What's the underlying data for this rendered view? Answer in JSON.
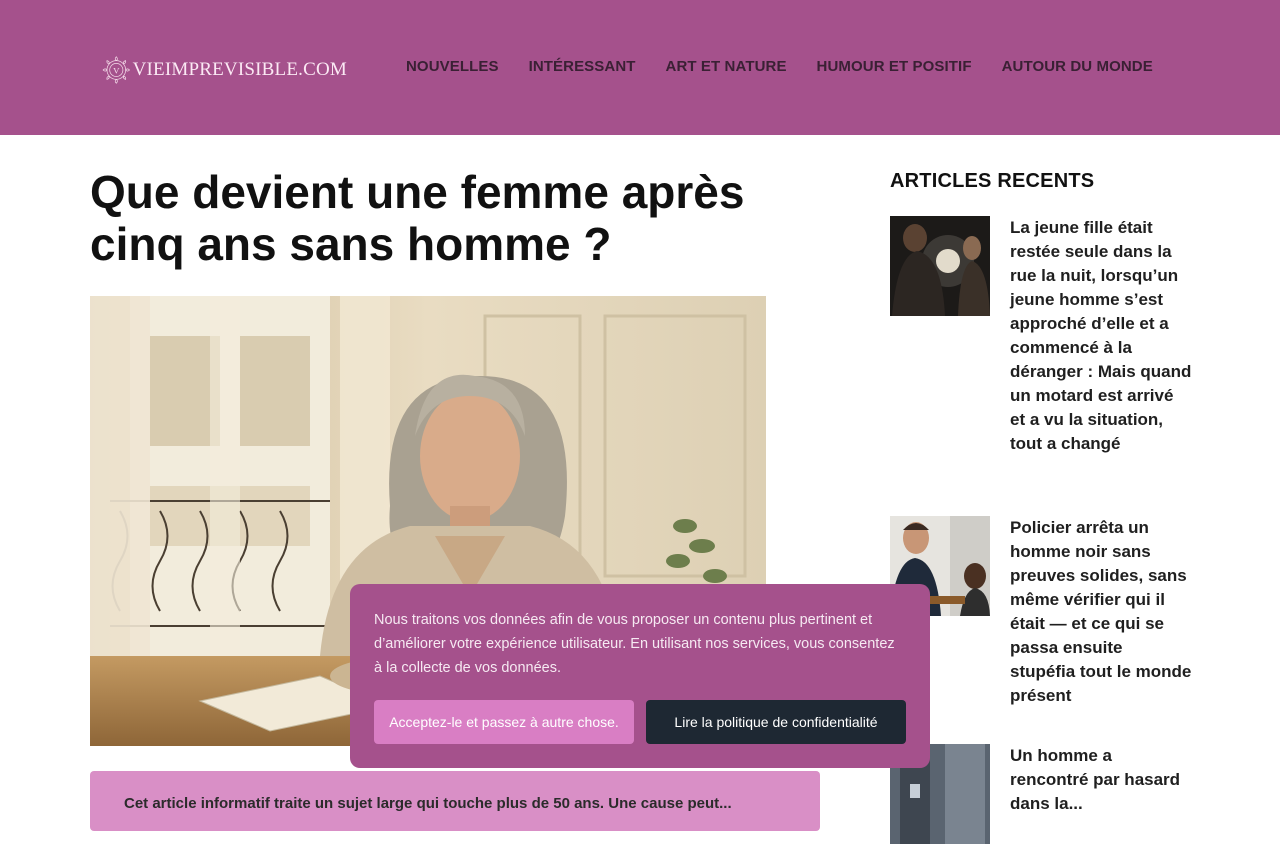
{
  "site": {
    "logo_letter": "V",
    "logo_text": "VIEIMPREVISIBLE.COM",
    "colors": {
      "header": "#a5518c",
      "accent": "#d97ec4",
      "dark_button": "#1e2833"
    }
  },
  "nav": {
    "items": [
      "NOUVELLES",
      "INTÉRESSANT",
      "ART ET NATURE",
      "HUMOUR ET POSITIF",
      "AUTOUR DU MONDE"
    ]
  },
  "article": {
    "title": "Que devient une femme après cinq ans sans homme ?",
    "intro": "Cet article informatif traite un sujet large qui touche plus de 50 ans. Une cause peut..."
  },
  "sidebar": {
    "heading": "ARTICLES RECENTS",
    "items": [
      {
        "title": "La jeune fille était restée seule dans la rue la nuit, lorsqu’un jeune homme s’est approché d’elle et a commencé à la déranger : Mais quand un motard est arrivé et a vu la situation, tout a changé"
      },
      {
        "title": "Policier arrêta un homme noir sans preuves solides, sans même vérifier qui il était — et ce qui se passa ensuite stupéfia tout le monde présent"
      },
      {
        "title": "Un homme a rencontré par hasard dans la..."
      }
    ]
  },
  "cookie": {
    "text": "Nous traitons vos données afin de vous proposer un contenu plus pertinent et d’améliorer votre expérience utilisateur. En utilisant nos services, vous consentez à la collecte de vos données.",
    "accept_label": "Acceptez-le et passez à autre chose.",
    "policy_label": "Lire la politique de confidentialité"
  }
}
